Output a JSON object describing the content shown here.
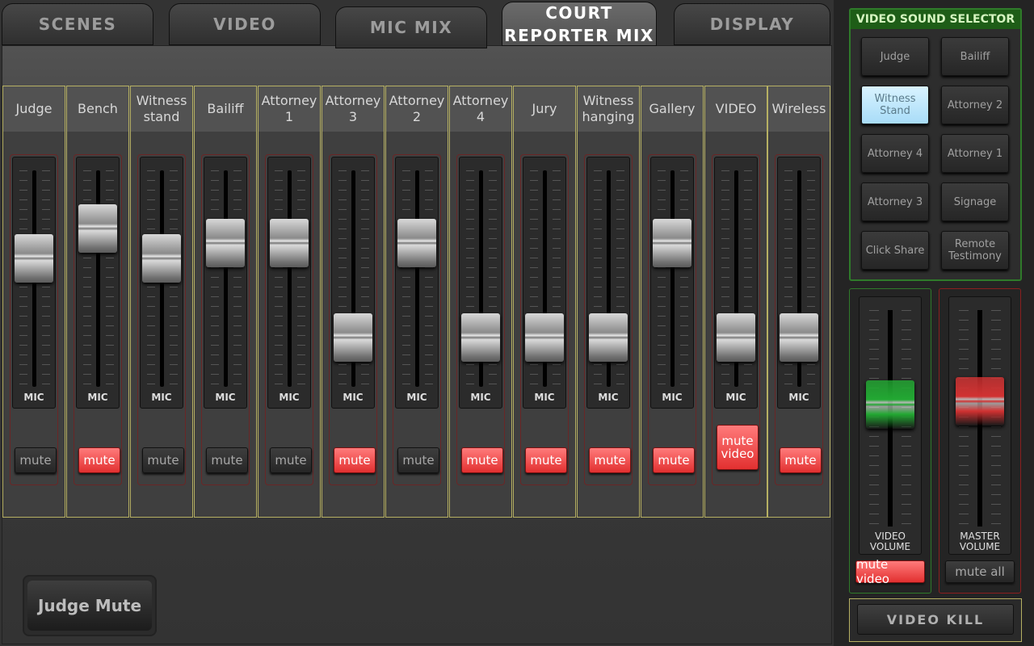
{
  "tabs": [
    {
      "label": "SCENES",
      "active": false
    },
    {
      "label": "VIDEO",
      "active": false
    },
    {
      "label": "MIC MIX",
      "active": false
    },
    {
      "label": "COURT REPORTER MIX",
      "active": true
    },
    {
      "label": "DISPLAY",
      "active": false
    }
  ],
  "channels": [
    {
      "name": "Judge",
      "fader_level": 0.62,
      "fader_label": "MIC",
      "mute_label": "mute",
      "muted": false
    },
    {
      "name": "Bench",
      "fader_level": 0.8,
      "fader_label": "MIC",
      "mute_label": "mute",
      "muted": true
    },
    {
      "name": "Witness stand",
      "fader_level": 0.62,
      "fader_label": "MIC",
      "mute_label": "mute",
      "muted": false
    },
    {
      "name": "Bailiff",
      "fader_level": 0.71,
      "fader_label": "MIC",
      "mute_label": "mute",
      "muted": false
    },
    {
      "name": "Attorney 1",
      "fader_level": 0.71,
      "fader_label": "MIC",
      "mute_label": "mute",
      "muted": false
    },
    {
      "name": "Attorney 3",
      "fader_level": 0.15,
      "fader_label": "MIC",
      "mute_label": "mute",
      "muted": true
    },
    {
      "name": "Attorney 2",
      "fader_level": 0.71,
      "fader_label": "MIC",
      "mute_label": "mute",
      "muted": false
    },
    {
      "name": "Attorney 4",
      "fader_level": 0.15,
      "fader_label": "MIC",
      "mute_label": "mute",
      "muted": true
    },
    {
      "name": "Jury",
      "fader_level": 0.15,
      "fader_label": "MIC",
      "mute_label": "mute",
      "muted": true
    },
    {
      "name": "Witness hanging",
      "fader_level": 0.15,
      "fader_label": "MIC",
      "mute_label": "mute",
      "muted": true
    },
    {
      "name": "Gallery",
      "fader_level": 0.71,
      "fader_label": "MIC",
      "mute_label": "mute",
      "muted": true
    },
    {
      "name": "VIDEO",
      "fader_level": 0.15,
      "fader_label": "MIC",
      "mute_label": "mute video",
      "muted": true
    },
    {
      "name": "Wireless",
      "fader_level": 0.15,
      "fader_label": "MIC",
      "mute_label": "mute",
      "muted": true
    }
  ],
  "judge_mute_label": "Judge Mute",
  "video_sound_selector": {
    "title": "VIDEO SOUND SELECTOR",
    "sources": [
      {
        "label": "Judge",
        "selected": false
      },
      {
        "label": "Bailiff",
        "selected": false
      },
      {
        "label": "Witness Stand",
        "selected": true
      },
      {
        "label": "Attorney 2",
        "selected": false
      },
      {
        "label": "Attorney 4",
        "selected": false
      },
      {
        "label": "Attorney 1",
        "selected": false
      },
      {
        "label": "Attorney 3",
        "selected": false
      },
      {
        "label": "Signage",
        "selected": false
      },
      {
        "label": "Click Share",
        "selected": false
      },
      {
        "label": "Remote Testimony",
        "selected": false
      }
    ]
  },
  "video_volume": {
    "label": "VIDEO VOLUME",
    "level": 0.58,
    "mute_label": "mute video",
    "muted": true,
    "color": "#22a832"
  },
  "master_volume": {
    "label": "MASTER VOLUME",
    "level": 0.6,
    "mute_label": "mute all",
    "muted": false,
    "color": "#d13232"
  },
  "video_kill_label": "VIDEO KILL",
  "colors": {
    "accent_green": "#2f7a2a",
    "accent_red": "#e23030",
    "channel_border": "#b6b063",
    "selected_blue": "#a8dcf8"
  }
}
